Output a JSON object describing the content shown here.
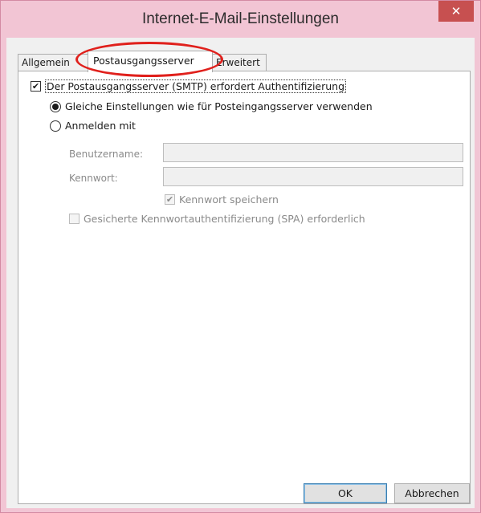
{
  "window": {
    "title": "Internet-E-Mail-Einstellungen",
    "close_glyph": "✕"
  },
  "tabs": [
    {
      "label": "Allgemein",
      "active": false
    },
    {
      "label": "Postausgangsserver",
      "active": true
    },
    {
      "label": "Erweitert",
      "active": false
    }
  ],
  "panel": {
    "smtp_auth": {
      "label": "Der Postausgangsserver (SMTP) erfordert Authentifizierung",
      "checked": true
    },
    "radio_same": {
      "label": "Gleiche Einstellungen wie für Posteingangsserver verwenden",
      "selected": true
    },
    "radio_login": {
      "label": "Anmelden mit",
      "selected": false
    },
    "username": {
      "label": "Benutzername:",
      "value": ""
    },
    "password": {
      "label": "Kennwort:",
      "value": ""
    },
    "save_password": {
      "label": "Kennwort speichern",
      "checked": true
    },
    "spa": {
      "label": "Gesicherte Kennwortauthentifizierung (SPA) erforderlich",
      "checked": false
    }
  },
  "buttons": {
    "ok": "OK",
    "cancel": "Abbrechen"
  },
  "colors": {
    "title_bg": "#f2c5d4",
    "close_bg": "#c75050",
    "annotation": "#e0201c"
  }
}
